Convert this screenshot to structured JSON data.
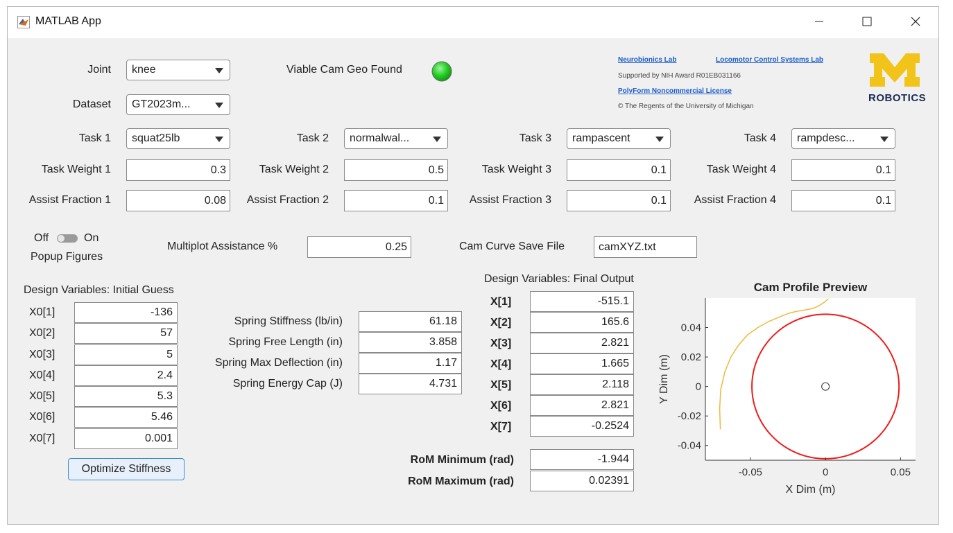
{
  "window": {
    "title": "MATLAB App"
  },
  "joint": {
    "label": "Joint",
    "value": "knee"
  },
  "dataset": {
    "label": "Dataset",
    "value": "GT2023m..."
  },
  "viable": {
    "label": "Viable Cam Geo Found",
    "status_color": "#22cc22"
  },
  "credits": {
    "lab1": "Neurobionics Lab",
    "lab2": "Locomotor Control Systems Lab",
    "award": "Supported by NIH Award R01EB031166",
    "license": "PolyForm Noncommercial License",
    "copyright": "© The Regents of the University of Michigan",
    "logo_text": "ROBOTICS",
    "logo_color": "#f2c318",
    "logo_text_color": "#1d2b50"
  },
  "tasks": [
    {
      "label": "Task 1",
      "value": "squat25lb",
      "weight_label": "Task Weight 1",
      "weight": "0.3",
      "assist_label": "Assist Fraction 1",
      "assist": "0.08"
    },
    {
      "label": "Task 2",
      "value": "normalwal...",
      "weight_label": "Task Weight 2",
      "weight": "0.5",
      "assist_label": "Assist Fraction 2",
      "assist": "0.1"
    },
    {
      "label": "Task 3",
      "value": "rampascent",
      "weight_label": "Task Weight 3",
      "weight": "0.1",
      "assist_label": "Assist Fraction 3",
      "assist": "0.1"
    },
    {
      "label": "Task 4",
      "value": "rampdesc...",
      "weight_label": "Task Weight 4",
      "weight": "0.1",
      "assist_label": "Assist Fraction 4",
      "assist": "0.1"
    }
  ],
  "popup": {
    "off": "Off",
    "on": "On",
    "label": "Popup Figures",
    "state": "Off"
  },
  "multiplot": {
    "label": "Multiplot Assistance %",
    "value": "0.25"
  },
  "camsave": {
    "label": "Cam Curve Save File",
    "value": "camXYZ.txt"
  },
  "initial": {
    "title": "Design Variables: Initial Guess",
    "rows": [
      {
        "label": "X0[1]",
        "value": "-136"
      },
      {
        "label": "X0[2]",
        "value": "57"
      },
      {
        "label": "X0[3]",
        "value": "5"
      },
      {
        "label": "X0[4]",
        "value": "2.4"
      },
      {
        "label": "X0[5]",
        "value": "5.3"
      },
      {
        "label": "X0[6]",
        "value": "5.46"
      },
      {
        "label": "X0[7]",
        "value": "0.001"
      }
    ]
  },
  "spring": [
    {
      "label": "Spring Stiffness (lb/in)",
      "value": "61.18"
    },
    {
      "label": "Spring Free Length (in)",
      "value": "3.858"
    },
    {
      "label": "Spring Max Deflection (in)",
      "value": "1.17"
    },
    {
      "label": "Spring Energy Cap (J)",
      "value": "4.731"
    }
  ],
  "optimize_button": "Optimize Stiffness",
  "final": {
    "title": "Design Variables: Final Output",
    "rows": [
      {
        "label": "X[1]",
        "value": "-515.1"
      },
      {
        "label": "X[2]",
        "value": "165.6"
      },
      {
        "label": "X[3]",
        "value": "2.821"
      },
      {
        "label": "X[4]",
        "value": "1.665"
      },
      {
        "label": "X[5]",
        "value": "2.118"
      },
      {
        "label": "X[6]",
        "value": "2.821"
      },
      {
        "label": "X[7]",
        "value": "-0.2524"
      }
    ]
  },
  "rom": [
    {
      "label": "RoM Minimum (rad)",
      "value": "-1.944"
    },
    {
      "label": "RoM Maximum (rad)",
      "value": "0.02391"
    }
  ],
  "chart_data": {
    "type": "line",
    "title": "Cam Profile Preview",
    "xlabel": "X Dim (m)",
    "ylabel": "Y Dim (m)",
    "xlim": [
      -0.08,
      0.06
    ],
    "ylim": [
      -0.05,
      0.06
    ],
    "xticks": [
      -0.05,
      0,
      0.05
    ],
    "xtick_labels": [
      "-0.05",
      "0",
      "0.05"
    ],
    "yticks": [
      -0.04,
      -0.02,
      0,
      0.02,
      0.04
    ],
    "ytick_labels": [
      "-0.04",
      "-0.02",
      "0",
      "0.02",
      "0.04"
    ],
    "grid": false,
    "series": [
      {
        "kind": "circle",
        "center": [
          0,
          0
        ],
        "radius": 0.049,
        "color": "#ee1c1c"
      },
      {
        "kind": "curve",
        "color": "#f0b93c",
        "x": [
          -0.07,
          -0.0705,
          -0.0698,
          -0.067,
          -0.063,
          -0.058,
          -0.052,
          -0.045,
          -0.038,
          -0.031,
          -0.025,
          -0.019,
          -0.013,
          -0.008,
          -0.004,
          -0.001,
          0.002
        ],
        "y": [
          -0.029,
          -0.015,
          -0.002,
          0.01,
          0.02,
          0.028,
          0.035,
          0.04,
          0.044,
          0.047,
          0.0495,
          0.051,
          0.052,
          0.053,
          0.055,
          0.057,
          0.0595
        ]
      },
      {
        "kind": "marker",
        "x": [
          0
        ],
        "y": [
          0
        ],
        "color": "#333333"
      }
    ]
  }
}
